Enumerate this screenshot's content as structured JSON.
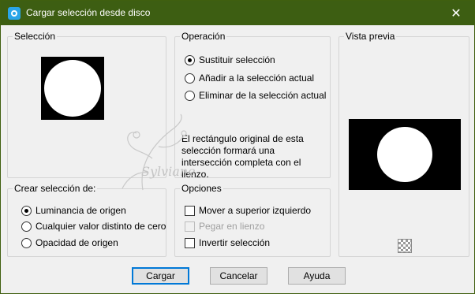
{
  "window": {
    "title": "Cargar selección desde disco",
    "close_glyph": "✕",
    "titlebar_color": "#3d5e12"
  },
  "selection_group": {
    "label": "Selección"
  },
  "operation_group": {
    "label": "Operación",
    "options": [
      {
        "label": "Sustituir selección",
        "selected": true
      },
      {
        "label": "Añadir a la selección actual",
        "selected": false
      },
      {
        "label": "Eliminar de la selección actual",
        "selected": false
      }
    ],
    "info": "El rectángulo original de esta selección formará una intersección completa con el lienzo."
  },
  "preview_group": {
    "label": "Vista previa",
    "checker_icon": "transparency-checker-icon"
  },
  "create_group": {
    "label": "Crear selección de:",
    "options": [
      {
        "label": "Luminancia de origen",
        "selected": true
      },
      {
        "label": "Cualquier valor distinto de cero",
        "selected": false
      },
      {
        "label": "Opacidad de origen",
        "selected": false
      }
    ]
  },
  "options_group": {
    "label": "Opciones",
    "checks": [
      {
        "label": "Mover a superior izquierdo",
        "checked": false,
        "enabled": true
      },
      {
        "label": "Pegar en lienzo",
        "checked": false,
        "enabled": false
      },
      {
        "label": "Invertir selección",
        "checked": false,
        "enabled": true
      }
    ]
  },
  "buttons": {
    "ok": "Cargar",
    "cancel": "Cancelar",
    "help": "Ayuda"
  },
  "watermark": {
    "text": "Sylviane"
  }
}
